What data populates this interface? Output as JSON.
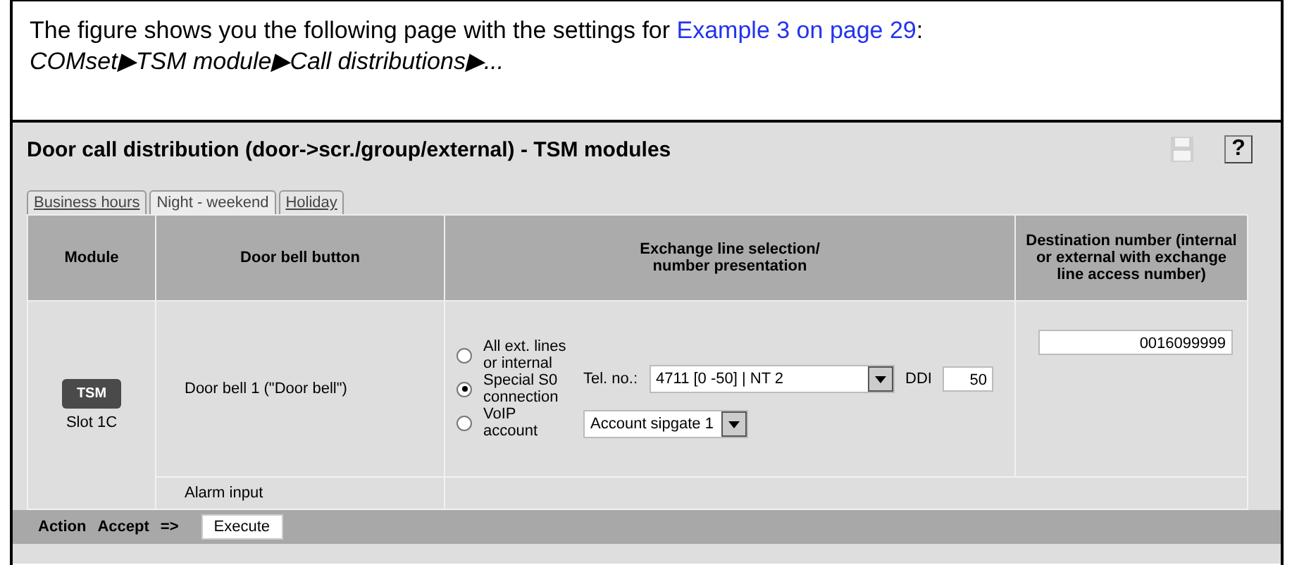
{
  "intro": {
    "text": "The figure shows you the following page with the settings for ",
    "link": "Example 3 on page 29",
    "suffix": ":",
    "path": [
      "COMset",
      "TSM module",
      "Call distributions",
      "..."
    ],
    "separator": "▶"
  },
  "page": {
    "title": "Door call distribution (door->scr./group/external) - TSM modules",
    "help": "?"
  },
  "tabs": [
    {
      "label": "Business hours",
      "selected": false
    },
    {
      "label": "Night - weekend",
      "selected": true
    },
    {
      "label": "Holiday",
      "selected": false
    }
  ],
  "table": {
    "columns": [
      "Module",
      "Door bell button",
      "Exchange line selection/\nnumber presentation",
      "Destination number (internal or external with exchange line access number)"
    ],
    "module": {
      "badge": "TSM",
      "slot": "Slot 1C"
    },
    "rows": [
      {
        "button": "Door bell 1  (\"Door bell\")",
        "options": [
          {
            "label": "All ext. lines or internal",
            "selected": false
          },
          {
            "label": "Special S0 connection",
            "selected": true
          },
          {
            "label": "VoIP account",
            "selected": false
          }
        ],
        "tel_label": "Tel. no.:",
        "tel_value": "4711 [0 -50] | NT 2",
        "ddi_label": "DDI",
        "ddi_value": "50",
        "voip_value": "Account sipgate 1",
        "destination": "0016099999"
      },
      {
        "button": "Alarm input"
      }
    ]
  },
  "action": {
    "label": "Action",
    "value": "Accept",
    "arrow": "=>",
    "button": "Execute"
  }
}
